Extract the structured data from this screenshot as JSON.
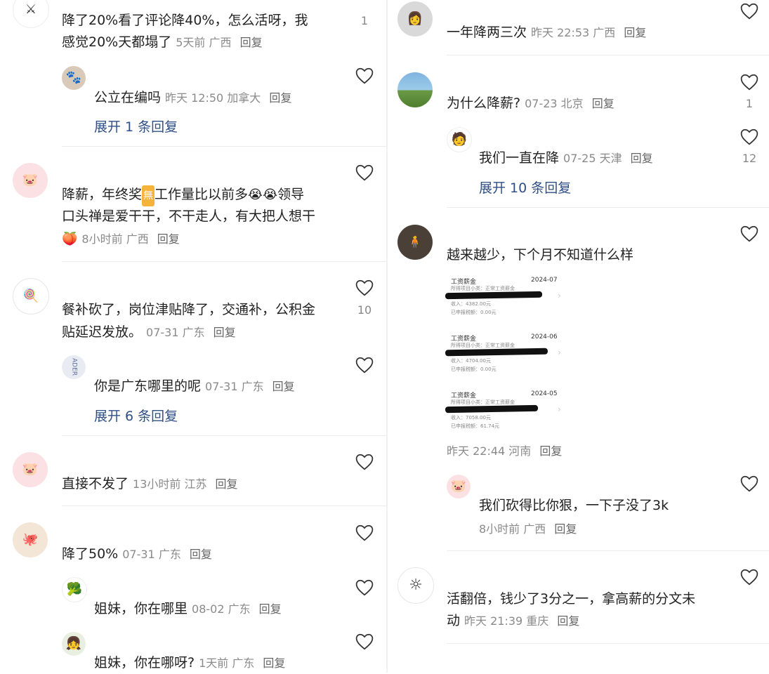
{
  "left": {
    "c1": {
      "text_l1": "降了20%看了评论降40%，怎么活呀，我",
      "text_l2": "感觉20%天都塌了",
      "meta": "5天前 广西",
      "reply": "回复",
      "likes": "1"
    },
    "c1r1": {
      "text": "公立在编吗",
      "meta": "昨天 12:50 加拿大",
      "reply": "回复"
    },
    "c1exp": "展开 1 条回复",
    "c2": {
      "text_l1a": "降薪，年终奖",
      "text_l1b": "工作量比以前多",
      "text_l1c": "领导",
      "text_l2": "口头禅是爱干干，不干走人，有大把人想干",
      "meta": "8小时前 广西",
      "reply": "回复"
    },
    "c3": {
      "text_l1": "餐补砍了，岗位津贴降了，交通补，公积金",
      "text_l2": "贴延迟发放。",
      "meta": "07-31 广东",
      "reply": "回复",
      "likes": "10"
    },
    "c3r1": {
      "text": "你是广东哪里的呢",
      "meta": "07-31 广东",
      "reply": "回复",
      "avatar_text": "ADER"
    },
    "c3exp": "展开 6 条回复",
    "c4": {
      "text": "直接不发了",
      "meta": "13小时前 江苏",
      "reply": "回复"
    },
    "c5": {
      "text": "降了50%",
      "meta": "07-31 广东",
      "reply": "回复"
    },
    "c5r1": {
      "text": "姐妹，你在哪里",
      "meta": "08-02 广东",
      "reply": "回复"
    },
    "c5r2": {
      "text": "姐妹，你在哪呀?",
      "meta": "1天前 广东",
      "reply": "回复"
    }
  },
  "right": {
    "c1": {
      "text": "一年降两三次",
      "meta": "昨天 22:53 广西",
      "reply": "回复"
    },
    "c2": {
      "text": "为什么降薪?",
      "meta": "07-23 北京",
      "reply": "回复",
      "likes": "1"
    },
    "c2r1": {
      "text": "我们一直在降",
      "meta": "07-25 天津",
      "reply": "回复",
      "likes": "12"
    },
    "c2exp": "展开 10 条回复",
    "c3": {
      "text": "越来越少，下个月不知道什么样",
      "meta": "昨天 22:44 河南",
      "reply": "回复"
    },
    "slips": [
      {
        "title": "工资薪金",
        "date": "2024-07",
        "sub": "所得项目小类：正常工资薪金",
        "income": "收入：4382.00元",
        "tax": "已申报税额：0.00元"
      },
      {
        "title": "工资薪金",
        "date": "2024-06",
        "sub": "所得项目小类：正常工资薪金",
        "income": "收入：4704.00元",
        "tax": "已申报税额：0.00元"
      },
      {
        "title": "工资薪金",
        "date": "2024-05",
        "sub": "所得项目小类：正常工资薪金",
        "income": "收入：7058.00元",
        "tax": "已申报税额：61.74元"
      }
    ],
    "c3r1": {
      "text": "我们砍得比你狠，一下子没了3k",
      "meta": "8小时前 广西",
      "reply": "回复"
    },
    "c4": {
      "text_l1": "活翻倍，钱少了3分之一，拿高薪的分文未",
      "text_l2": "动",
      "meta": "昨天 21:39 重庆",
      "reply": "回复"
    }
  }
}
